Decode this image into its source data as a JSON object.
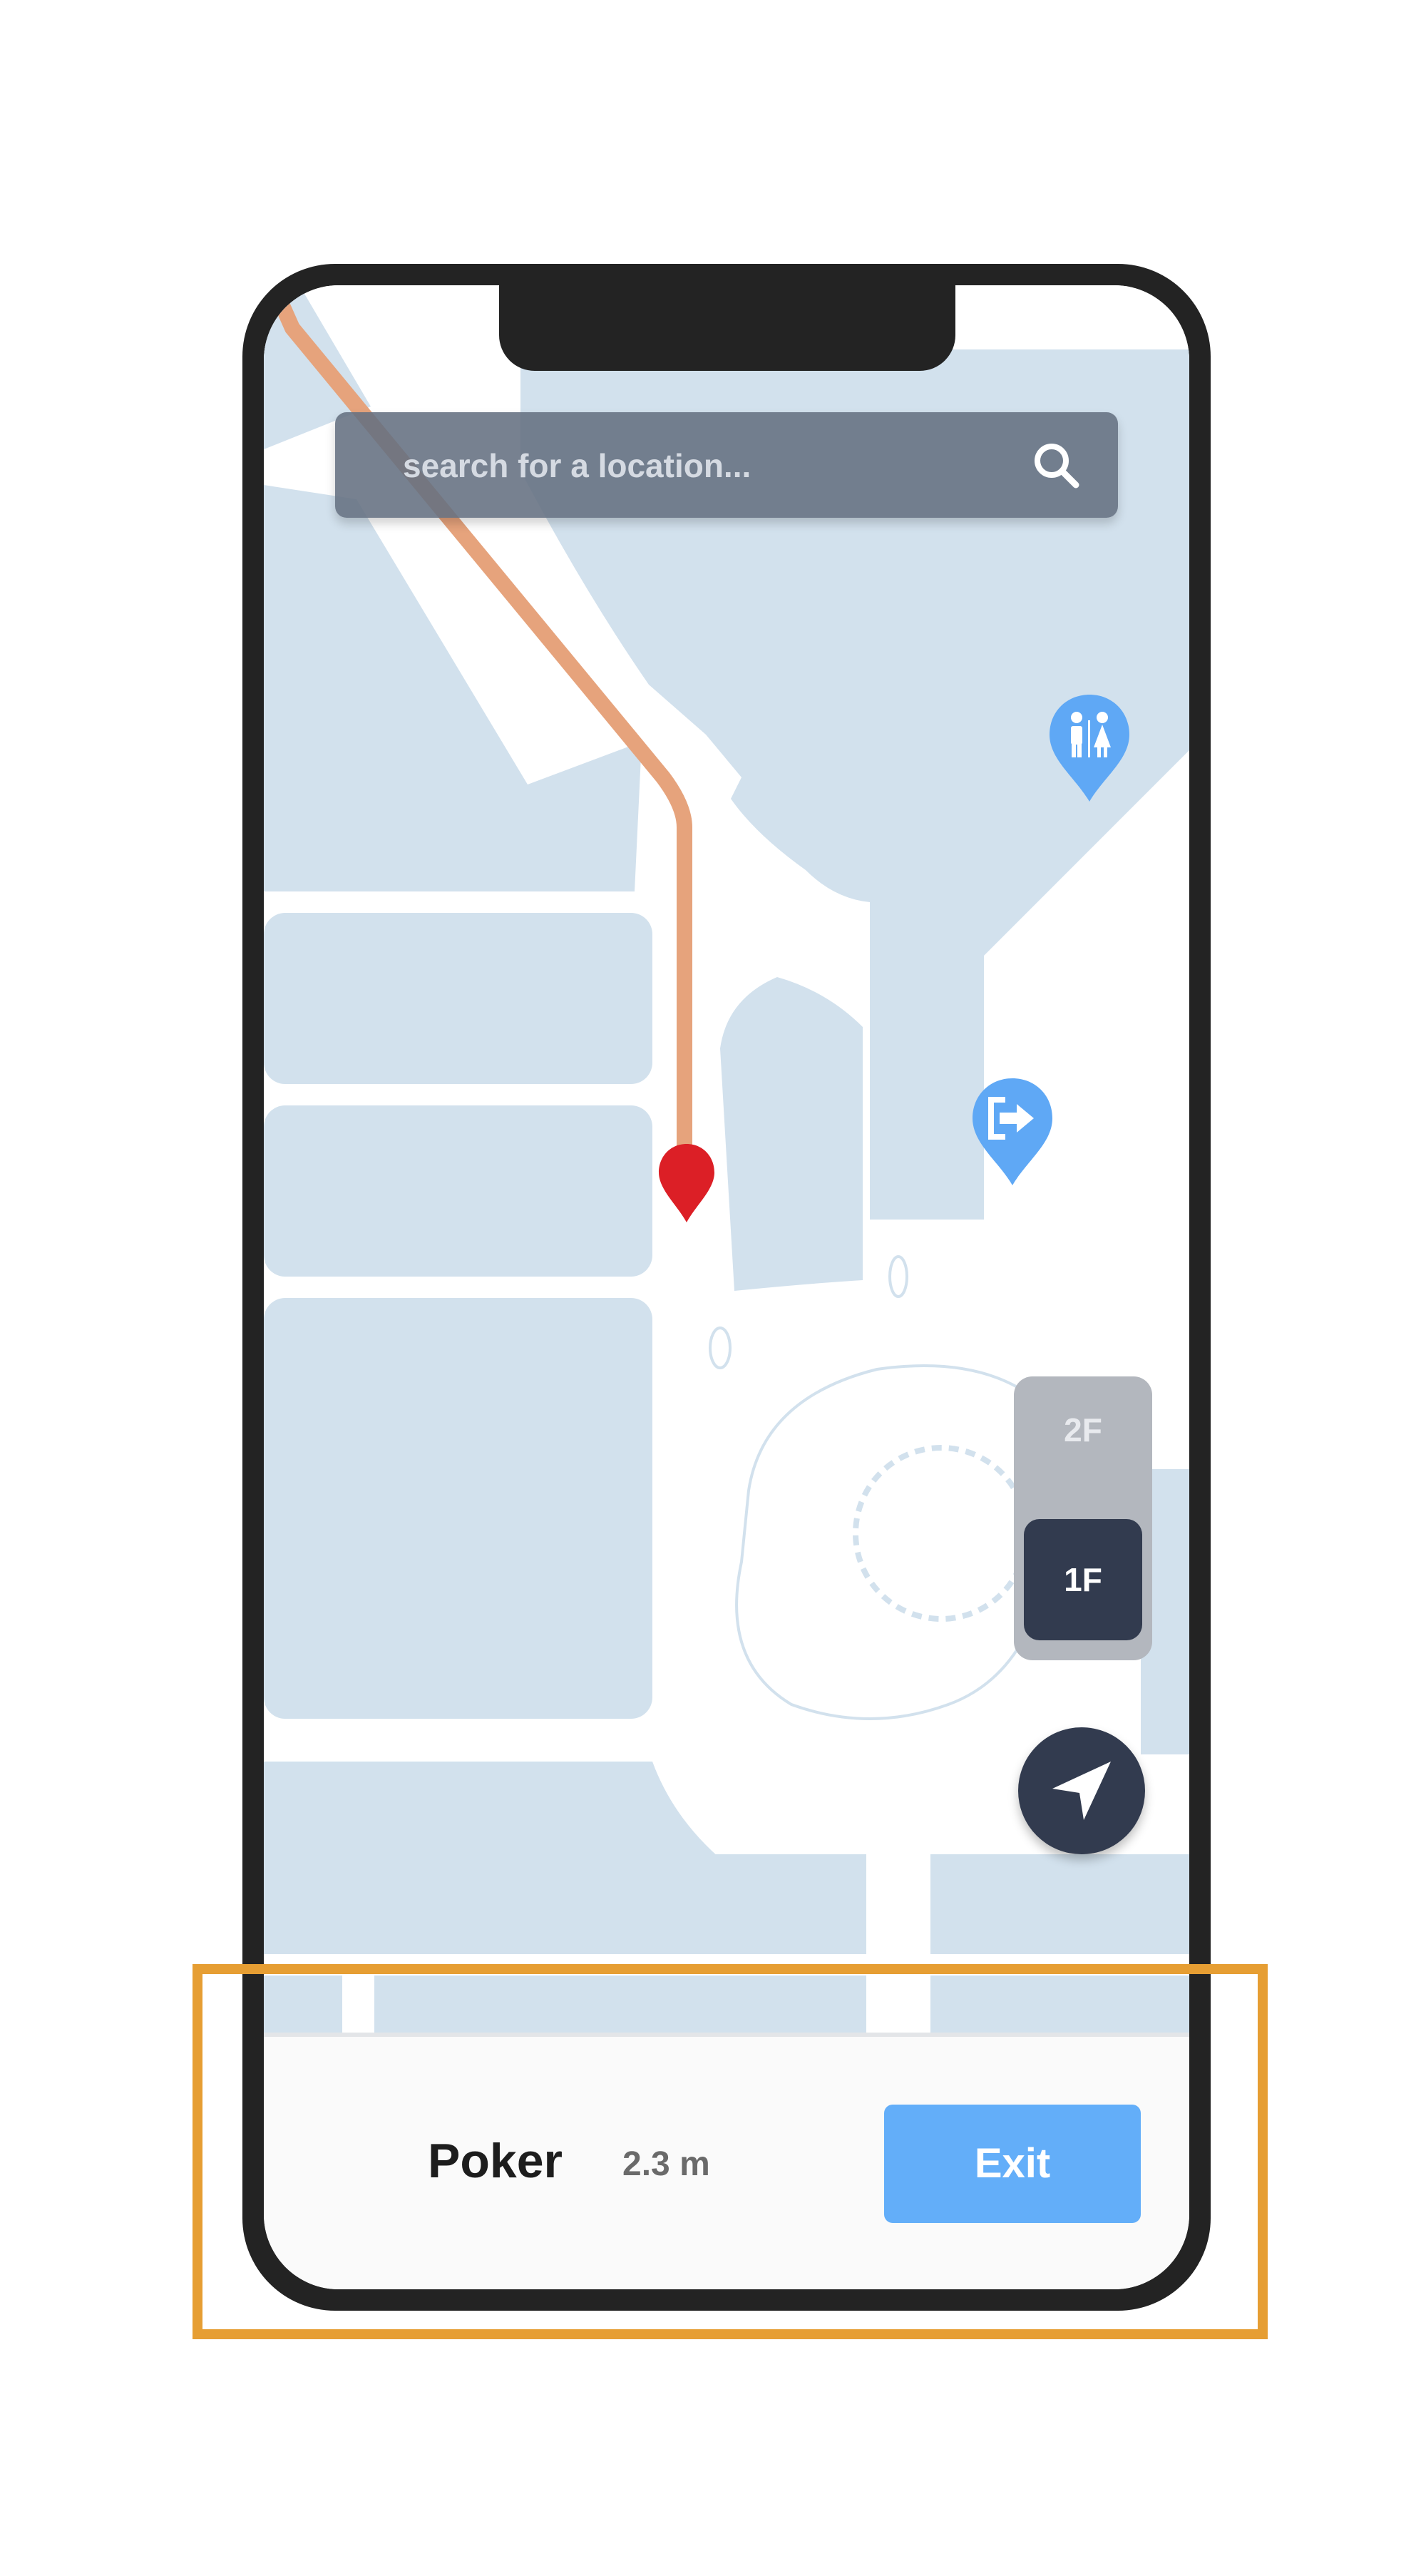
{
  "search": {
    "placeholder": "search for a location..."
  },
  "map": {
    "building_color": "#d2e1ed",
    "route_color": "#e6a37c",
    "destination_pin_color": "#dc1f26",
    "poi_pin_color": "#5fa8f5",
    "pois": [
      {
        "icon": "restroom-icon"
      },
      {
        "icon": "exit-door-icon"
      }
    ]
  },
  "floors": {
    "levels": [
      "2F",
      "1F"
    ],
    "selected": "1F"
  },
  "navigation": {
    "destination": "Poker",
    "distance": "2.3 m",
    "exit_label": "Exit"
  }
}
